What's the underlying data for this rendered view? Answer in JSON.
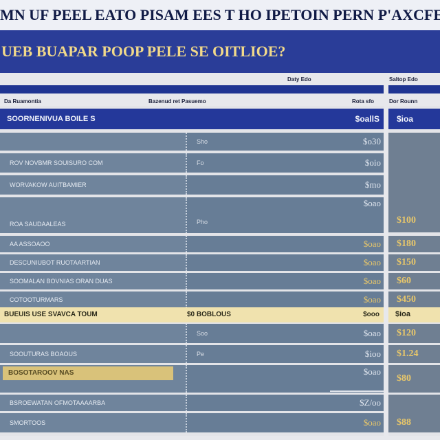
{
  "title": "MN UF PEEL EATO PISAM EES T HO IPETOIN PERN P'AXCFE?",
  "subtitle": "UEB BUAPAR POOP PELE SE OITLIOE?",
  "header": {
    "top_label_a": "Daty Edo",
    "top_label_b": "Saltop Edo",
    "col_a": "Da Ruamontia",
    "col_b": "Bazenud ret Pasuemo",
    "col_c": "Rota sfo",
    "col_d": "Dor Rounn"
  },
  "category": {
    "label": "SOORNENIVUA BOILE S",
    "value_left": "$oallS",
    "value_right": "$ioa"
  },
  "rows": [
    {
      "label": "",
      "note": "Sho",
      "price": "$o30"
    },
    {
      "label": "ROV NOVBMR SOUISURO COM",
      "note": "Fo",
      "price": "$oio"
    },
    {
      "label": "WORVAKOW AUITBAMIER",
      "note": "",
      "price": "$mo"
    },
    {
      "label": "ROA SAUDAALEAS",
      "note": "Pho",
      "price": "$oao"
    },
    {
      "label": "AA ASSOAOO",
      "note": "",
      "price": "$oao"
    },
    {
      "label": "DESCUNIUBOT RUOTAARTIAN",
      "note": "",
      "price": "$oao"
    },
    {
      "label": "SOOMALAN BOVNIAS ORAN DUAS",
      "note": "",
      "price": "$oao"
    },
    {
      "label": "COTOOTURMARS",
      "note": "",
      "price": "$oao"
    }
  ],
  "right_prices": [
    "$100",
    "$180",
    "$150",
    "$60",
    "$450",
    "$120",
    "$1.24",
    "$80",
    "$88"
  ],
  "highlight": {
    "label": "BUEUIS USE SVAVCA TOUM",
    "mid": "$0 BOBLOUS",
    "value": "$ooo",
    "value_right": "$ioa"
  },
  "rows2": [
    {
      "label": "",
      "note": "Soo",
      "price": "$oao"
    },
    {
      "label": "SOOUTURAS BOAOUS",
      "note": "Pe",
      "price": "$ioo"
    },
    {
      "label": "BOSOTAROOV NAS",
      "note": "",
      "price": "$oao"
    },
    {
      "label": "BSROEWATAN OFMOTAAAARBA",
      "note": "",
      "price": "$Z/oo"
    },
    {
      "label": "SMORTOOS",
      "note": "",
      "price": "$oao"
    }
  ]
}
